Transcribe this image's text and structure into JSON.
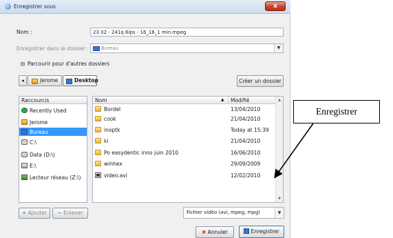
{
  "window": {
    "title": "Enregistrer sous",
    "close_glyph": "x"
  },
  "form": {
    "name_label": "Nom :",
    "name_value": "23 02 - 241q 6ips - 16_16_1 min.mpeg",
    "save_in_label": "Enregistrer dans le dossier :",
    "save_in_value": "Bureau",
    "browse_toggle": "Parcourir pour d'autres dossiers",
    "browse_toggle_glyph": "⊟"
  },
  "pathbar": {
    "back_glyph": "◂",
    "buttons": [
      "Jerome",
      "Desktop"
    ],
    "create_folder": "Créer un dossier"
  },
  "places": {
    "header": "Raccourcis",
    "items": [
      {
        "label": "Recently Used",
        "icon": "recent-icon"
      },
      {
        "label": "Jerome",
        "icon": "home-folder-icon"
      },
      {
        "label": "Bureau",
        "icon": "desktop-icon",
        "selected": true
      },
      {
        "label": "C:\\",
        "icon": "drive-icon"
      },
      {
        "label": "Data (D:\\)",
        "icon": "drive-icon"
      },
      {
        "label": "E:\\",
        "icon": "drive-icon"
      },
      {
        "label": "Lecteur réseau (Z:\\)",
        "icon": "network-drive-icon"
      }
    ],
    "add_button": "Ajouter",
    "remove_button": "Enlever"
  },
  "files": {
    "columns": {
      "name": "Nom",
      "modified": "Modifié",
      "sort_glyph": "▲"
    },
    "rows": [
      {
        "name": "Bordel",
        "modified": "13/04/2010",
        "type": "folder"
      },
      {
        "name": "cook",
        "modified": "21/04/2010",
        "type": "folder"
      },
      {
        "name": "inoptk",
        "modified": "Today at 15:39",
        "type": "folder"
      },
      {
        "name": "ki",
        "modified": "21/04/2010",
        "type": "folder"
      },
      {
        "name": "Po easydentic inno juin 2010",
        "modified": "16/06/2010",
        "type": "folder"
      },
      {
        "name": "winhex",
        "modified": "29/09/2009",
        "type": "folder"
      },
      {
        "name": "video.avi",
        "modified": "12/02/2010",
        "type": "video"
      }
    ]
  },
  "filter": {
    "value": "Fichier vidéo (avi, mpeg, mpg)"
  },
  "actions": {
    "cancel": "Annuler",
    "save": "Enregistrer"
  },
  "annotation": {
    "label": "Enregistrer"
  }
}
